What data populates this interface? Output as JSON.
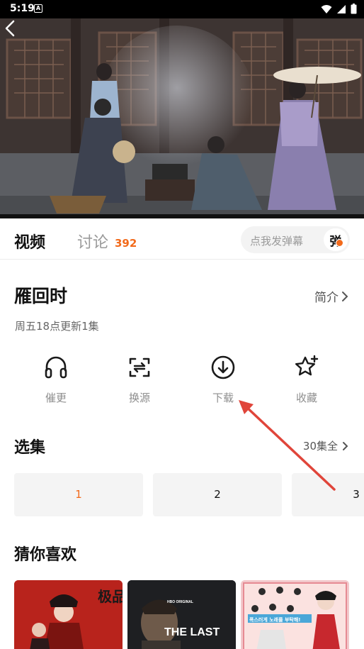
{
  "status_bar": {
    "time": "5:19",
    "notif_glyph": "A"
  },
  "tabs": {
    "video": "视频",
    "discuss": "讨论",
    "discuss_count": "392"
  },
  "danmaku": {
    "placeholder": "点我发弹幕",
    "button_label": "弹"
  },
  "show": {
    "title": "雁回时",
    "intro_label": "简介",
    "update_info": "周五18点更新1集"
  },
  "actions": [
    {
      "label": "催更",
      "icon": "headphones-icon"
    },
    {
      "label": "换源",
      "icon": "switch-source-icon"
    },
    {
      "label": "下载",
      "icon": "download-icon"
    },
    {
      "label": "收藏",
      "icon": "star-add-icon"
    }
  ],
  "episodes": {
    "title": "选集",
    "count_label": "30集全",
    "items": [
      "1",
      "2",
      "3"
    ],
    "active_index": 0
  },
  "recommend": {
    "title": "猜你喜欢",
    "posters": [
      {
        "title_art": "极品"
      },
      {
        "title_art": "THE LAST",
        "badge": "HBO ORIGINAL"
      },
      {
        "title_art": "폭스러게 노래를 부탁해!"
      }
    ]
  },
  "colors": {
    "accent": "#f26a1b",
    "annotation": "#e0453a"
  }
}
